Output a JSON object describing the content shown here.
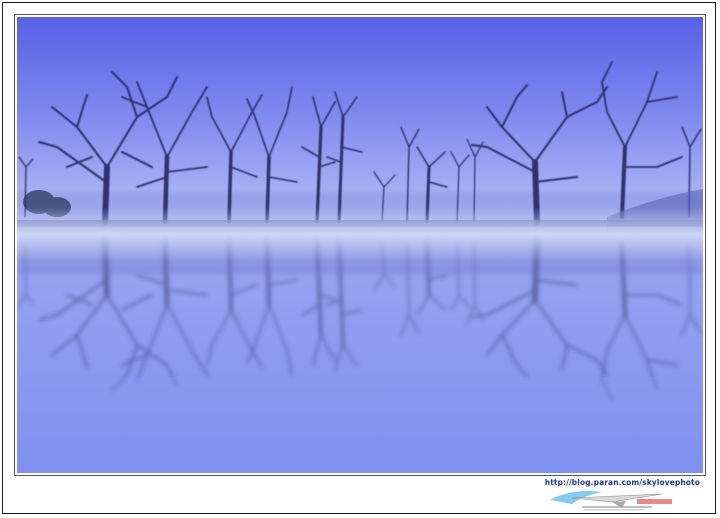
{
  "photo": {
    "subject": "misty lake with bare trees reflected",
    "colors": {
      "sky_top": "#5a62e8",
      "sky_horizon": "#b9c2f4",
      "fog": "#c8cff5",
      "tree": "#2e3170",
      "water": "#8c9af0",
      "water_bottom": "#7d8ef0"
    }
  },
  "watermark": {
    "url": "http://blog.paran.com/skylovephoto",
    "logo_icon": "paper-plane-logo"
  }
}
